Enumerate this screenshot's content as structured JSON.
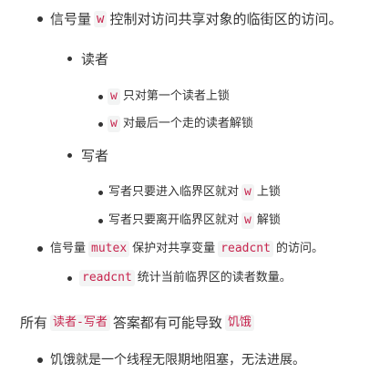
{
  "items": [
    {
      "before": "信号量",
      "code": "w",
      "after": "控制对访问共享对象的临街区的访问。"
    },
    {
      "label": "读者"
    },
    {
      "code": "w",
      "after": "只对第一个读者上锁"
    },
    {
      "code": "w",
      "after": "对最后一个走的读者解锁"
    },
    {
      "label": "写者"
    },
    {
      "before": "写者只要进入临界区就对",
      "code": "w",
      "after": "上锁"
    },
    {
      "before": "写者只要离开临界区就对",
      "code": "w",
      "after": "解锁"
    },
    {
      "before": "信号量",
      "code": "mutex",
      "middle": "保护对共享变量",
      "code2": "readcnt",
      "after": "的访问。"
    },
    {
      "code": "readcnt",
      "after": "统计当前临界区的读者数量。"
    }
  ],
  "paragraph": {
    "before": "所有",
    "code": "读者-写者",
    "middle": "答案都有可能导致",
    "code2": "饥饿"
  },
  "last_item": {
    "text": "饥饿就是一个线程无限期地阻塞，无法进展。"
  }
}
